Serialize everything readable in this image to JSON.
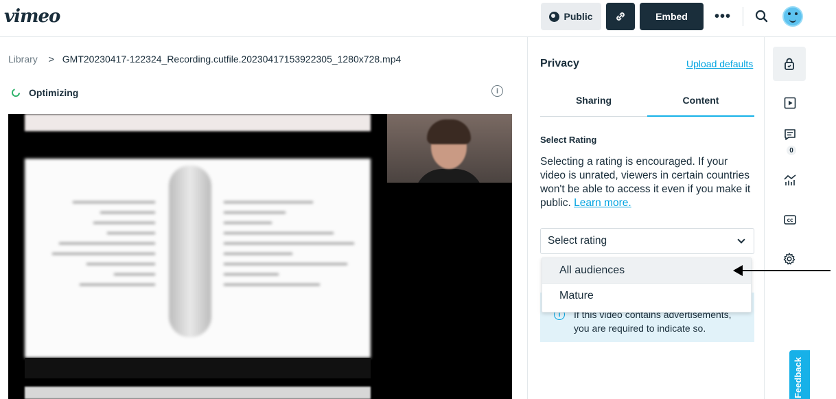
{
  "header": {
    "logo": "vimeo",
    "public_label": "Public",
    "embed_label": "Embed",
    "more_label": "•••"
  },
  "breadcrumb": {
    "root": "Library",
    "separator": ">",
    "file": "GMT20230417-122324_Recording.cutfile.20230417153922305_1280x728.mp4"
  },
  "status": {
    "label": "Optimizing"
  },
  "panel": {
    "title": "Privacy",
    "upload_defaults": "Upload defaults",
    "tabs": [
      {
        "label": "Sharing",
        "active": false
      },
      {
        "label": "Content",
        "active": true
      }
    ],
    "section_title": "Select Rating",
    "description": "Selecting a rating is encouraged. If your video is unrated, viewers in certain countries won't be able to access it even if you make it public.",
    "learn_more": "Learn more.",
    "select_placeholder": "Select rating",
    "options": [
      "All audiences",
      "Mature"
    ],
    "notice_line1": "If this video contains advertisements,",
    "notice_line2": "you are required to indicate so."
  },
  "rail": {
    "comments_count": "0",
    "feedback_label": "Feedback"
  },
  "colors": {
    "brand_dark": "#1a2e3b",
    "accent": "#17b1e8",
    "link": "#00a3e0"
  }
}
